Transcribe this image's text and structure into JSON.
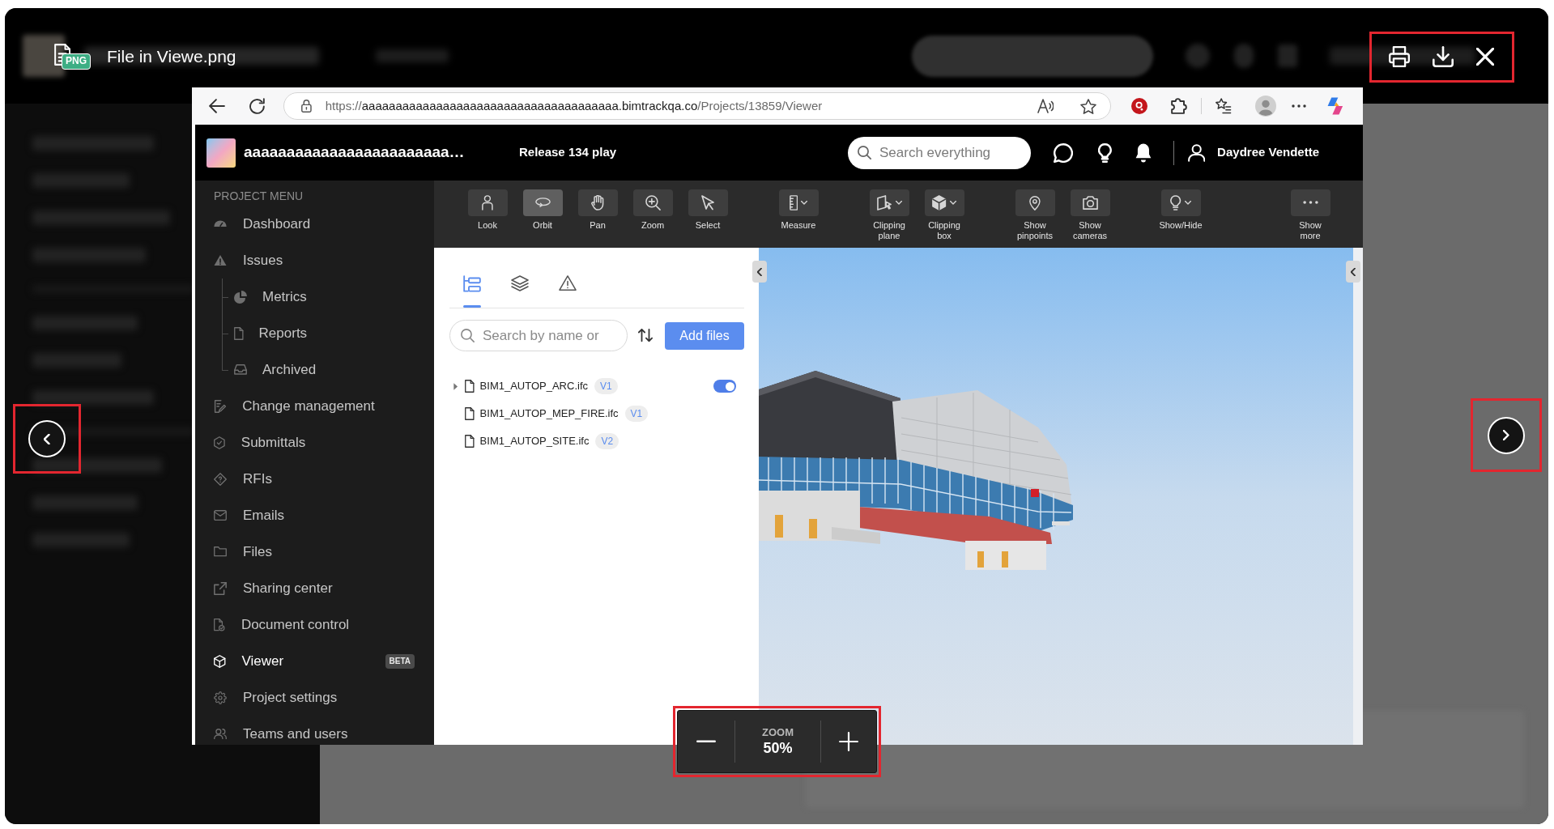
{
  "lightbox": {
    "file_badge": "PNG",
    "title": "File in Viewe.png",
    "actions_highlighted": true,
    "previous_highlighted": true,
    "next_highlighted": true,
    "zoom": {
      "label": "ZOOM",
      "value": "50%",
      "highlighted": true
    }
  },
  "browser": {
    "url": {
      "scheme": "https://",
      "host": "aaaaaaaaaaaaaaaaaaaaaaaaaaaaaaaaaaaaaa.bimtrackqa.co",
      "path": "/Projects/13859/Viewer"
    }
  },
  "app": {
    "header": {
      "project_name": "aaaaaaaaaaaaaaaaaaaaaaaa…",
      "release": "Release 134 play",
      "search": {
        "placeholder": "Search everything"
      },
      "user_name": "Daydree Vendette"
    },
    "sidebar": {
      "heading": "PROJECT MENU",
      "items": [
        {
          "label": "Dashboard",
          "selected": false
        },
        {
          "label": "Issues",
          "selected": false,
          "children": [
            {
              "label": "Metrics",
              "selected": false
            },
            {
              "label": "Reports",
              "selected": false
            },
            {
              "label": "Archived",
              "selected": false
            }
          ]
        },
        {
          "label": "Change management",
          "selected": false
        },
        {
          "label": "Submittals",
          "selected": false
        },
        {
          "label": "RFIs",
          "selected": false
        },
        {
          "label": "Emails",
          "selected": false
        },
        {
          "label": "Files",
          "selected": false
        },
        {
          "label": "Sharing center",
          "selected": false
        },
        {
          "label": "Document control",
          "selected": false
        },
        {
          "label": "Viewer",
          "selected": true,
          "badge": "BETA"
        },
        {
          "label": "Project settings",
          "selected": false
        },
        {
          "label": "Teams and users",
          "selected": false
        }
      ]
    },
    "toolbar": {
      "groups": [
        [
          {
            "label": "Look",
            "selected": false,
            "dropdown": false
          },
          {
            "label": "Orbit",
            "selected": true,
            "dropdown": false
          },
          {
            "label": "Pan",
            "selected": false,
            "dropdown": false
          },
          {
            "label": "Zoom",
            "selected": false,
            "dropdown": false
          },
          {
            "label": "Select",
            "selected": false,
            "dropdown": false
          }
        ],
        [
          {
            "label": "Measure",
            "selected": false,
            "dropdown": true
          }
        ],
        [
          {
            "label": "Clipping plane",
            "selected": false,
            "dropdown": true
          },
          {
            "label": "Clipping box",
            "selected": false,
            "dropdown": true
          }
        ],
        [
          {
            "label": "Show pinpoints",
            "selected": false,
            "dropdown": false
          },
          {
            "label": "Show cameras",
            "selected": false,
            "dropdown": false
          }
        ],
        [
          {
            "label": "Show/Hide",
            "selected": false,
            "dropdown": true
          }
        ],
        [
          {
            "label": "Show more",
            "selected": false,
            "dropdown": false
          }
        ]
      ]
    },
    "files_panel": {
      "tabs": [
        {
          "selected": true
        },
        {
          "selected": false
        },
        {
          "selected": false
        }
      ],
      "search": {
        "placeholder": "Search by name or"
      },
      "add_button": "Add files",
      "files": [
        {
          "name": "BIM1_AUTOP_ARC.ifc",
          "version": "V1",
          "expandable": true,
          "visible": true
        },
        {
          "name": "BIM1_AUTOP_MEP_FIRE.ifc",
          "version": "V1",
          "expandable": false
        },
        {
          "name": "BIM1_AUTOP_SITE.ifc",
          "version": "V2",
          "expandable": false
        }
      ]
    }
  }
}
